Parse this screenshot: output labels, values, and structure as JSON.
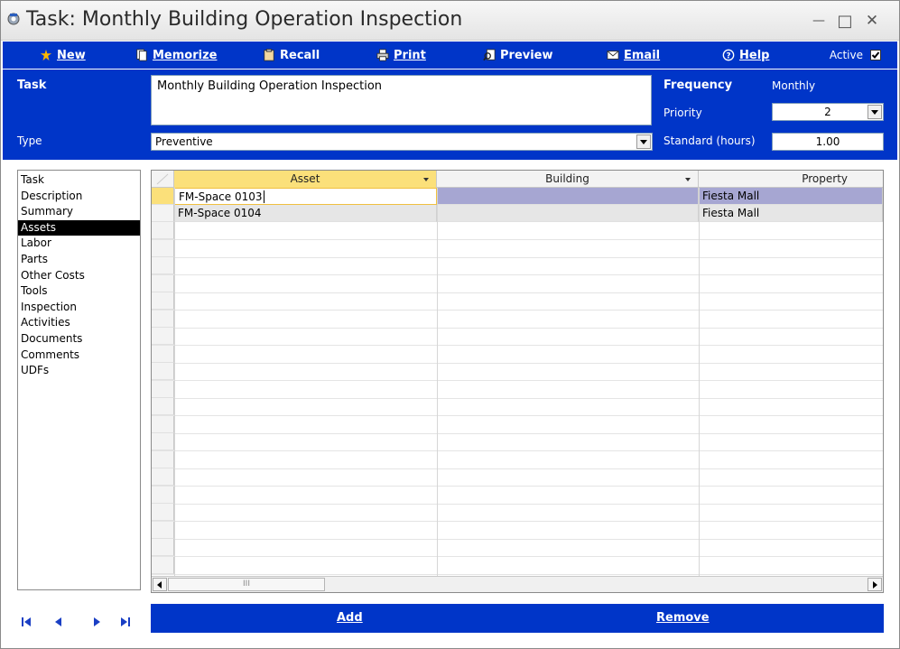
{
  "window": {
    "title": "Task:  Monthly Building Operation Inspection",
    "minimize_glyph": "—",
    "maximize_glyph": "□",
    "close_glyph": "✕"
  },
  "toolbar": {
    "new_label": "New",
    "memorize_label": "Memorize",
    "recall_label": "Recall",
    "print_label": "Print",
    "preview_label": "Preview",
    "email_label": "Email",
    "help_label": "Help",
    "active_label": "Active",
    "active_checked": true,
    "accent_color": "#0035c8",
    "new_icon_color": "#ffb800"
  },
  "header": {
    "task_label": "Task",
    "task_value": "Monthly Building Operation Inspection",
    "type_label": "Type",
    "type_value": "Preventive",
    "frequency_label": "Frequency",
    "frequency_value": "Monthly",
    "priority_label": "Priority",
    "priority_value": "2",
    "standard_label": "Standard (hours)",
    "standard_value": "1.00"
  },
  "nav": {
    "items": [
      {
        "label": "Task"
      },
      {
        "label": "Description"
      },
      {
        "label": "Summary"
      },
      {
        "label": "Assets"
      },
      {
        "label": "Labor"
      },
      {
        "label": "Parts"
      },
      {
        "label": "Other Costs"
      },
      {
        "label": "Tools"
      },
      {
        "label": "Inspection"
      },
      {
        "label": "Activities"
      },
      {
        "label": "Documents"
      },
      {
        "label": "Comments"
      },
      {
        "label": "UDFs"
      }
    ],
    "selected": "Assets"
  },
  "grid": {
    "columns": [
      "Asset",
      "Building",
      "Property"
    ],
    "rows": [
      {
        "asset": "FM-Space 0103",
        "building": "",
        "property": "Fiesta Mall"
      },
      {
        "asset": "FM-Space 0104",
        "building": "",
        "property": "Fiesta Mall"
      }
    ],
    "scroll_thumb_glyph": "III"
  },
  "actions": {
    "add_label": "Add",
    "remove_label": "Remove"
  }
}
